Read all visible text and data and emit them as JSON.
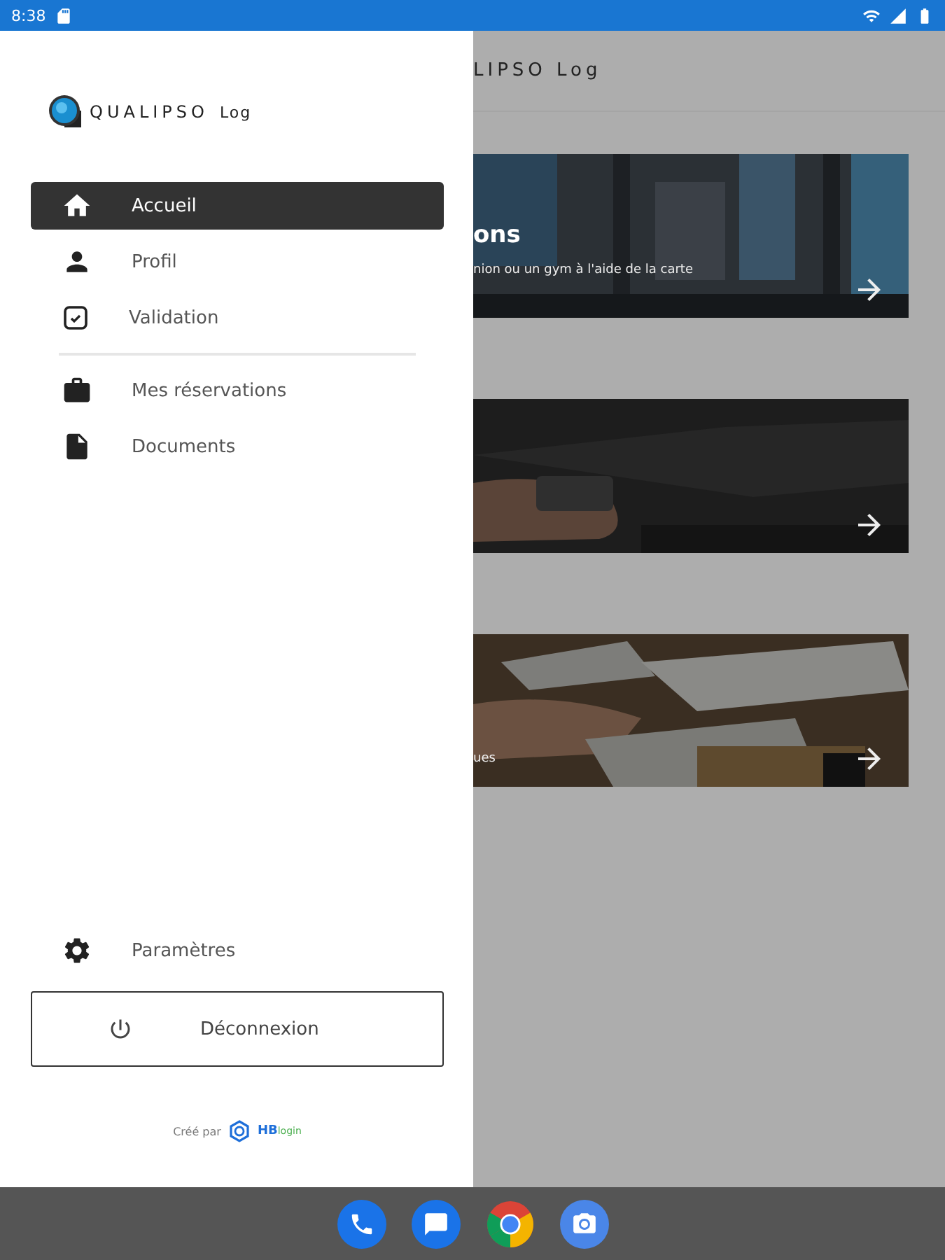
{
  "status_bar": {
    "time": "8:38"
  },
  "drawer": {
    "logo": {
      "name": "QUALIPSO",
      "suffix": "Log"
    },
    "items": [
      {
        "label": "Accueil",
        "selected": true
      },
      {
        "label": "Profil",
        "selected": false
      },
      {
        "label": "Validation",
        "selected": false
      },
      {
        "label": "Mes réservations",
        "selected": false
      },
      {
        "label": "Documents",
        "selected": false
      }
    ],
    "settings": {
      "label": "Paramètres"
    },
    "logout": {
      "label": "Déconnexion"
    },
    "credit": {
      "text": "Créé par",
      "brand": "HB",
      "brand_suffix": "login"
    }
  },
  "background": {
    "app_title": "LIPSO Log",
    "cards": [
      {
        "kind": "picture",
        "title": "ons",
        "subtitle": "nion ou un gym à l'aide de la carte"
      },
      {
        "kind": "picture"
      },
      {
        "kind": "picture",
        "subtitle": "ues"
      }
    ]
  }
}
